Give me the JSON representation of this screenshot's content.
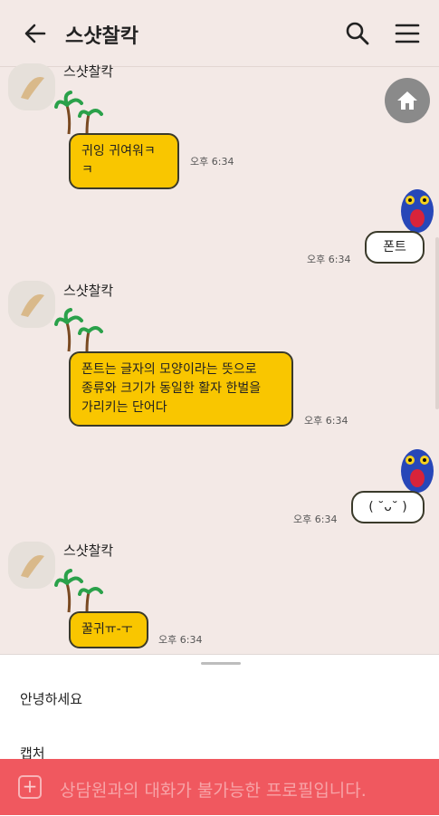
{
  "header": {
    "title": "스샷찰칵",
    "back_icon": "arrow-left-icon",
    "search_icon": "search-icon",
    "menu_icon": "hamburger-menu-icon"
  },
  "home_button": {
    "icon": "home-icon"
  },
  "messages": [
    {
      "side": "left",
      "sender": "스샷찰칵",
      "text": "귀잉 귀여워ㅋㅋ",
      "time": "오후 6:34"
    },
    {
      "side": "right",
      "text": "폰트",
      "time": "오후 6:34"
    },
    {
      "side": "left",
      "sender": "스샷찰칵",
      "text": "폰트는 글자의 모양이라는 뜻으로 종류와 크기가 동일한 활자 한벌을 가리키는 단어다",
      "text_lines": [
        "폰트는 글자의 모양이라는 뜻으로",
        "종류와 크기가 동일한 활자 한벌을",
        "가리키는 단어다"
      ],
      "time": "오후 6:34"
    },
    {
      "side": "right",
      "text": "( ˘ᴗ˘ )",
      "time": "오후 6:34"
    },
    {
      "side": "left",
      "sender": "스샷찰칵",
      "text": "꿀귀ㅠ-ㅜ",
      "time": "오후 6:34"
    }
  ],
  "quick_replies": [
    "안녕하세요",
    "캡처"
  ],
  "footer": {
    "plus_icon": "plus-icon",
    "notice": "상담원과의 대화가 불가능한 프로필입니다."
  },
  "colors": {
    "background": "#f3e9e6",
    "bubble_yellow": "#f9c600",
    "footer": "#f0585f"
  }
}
